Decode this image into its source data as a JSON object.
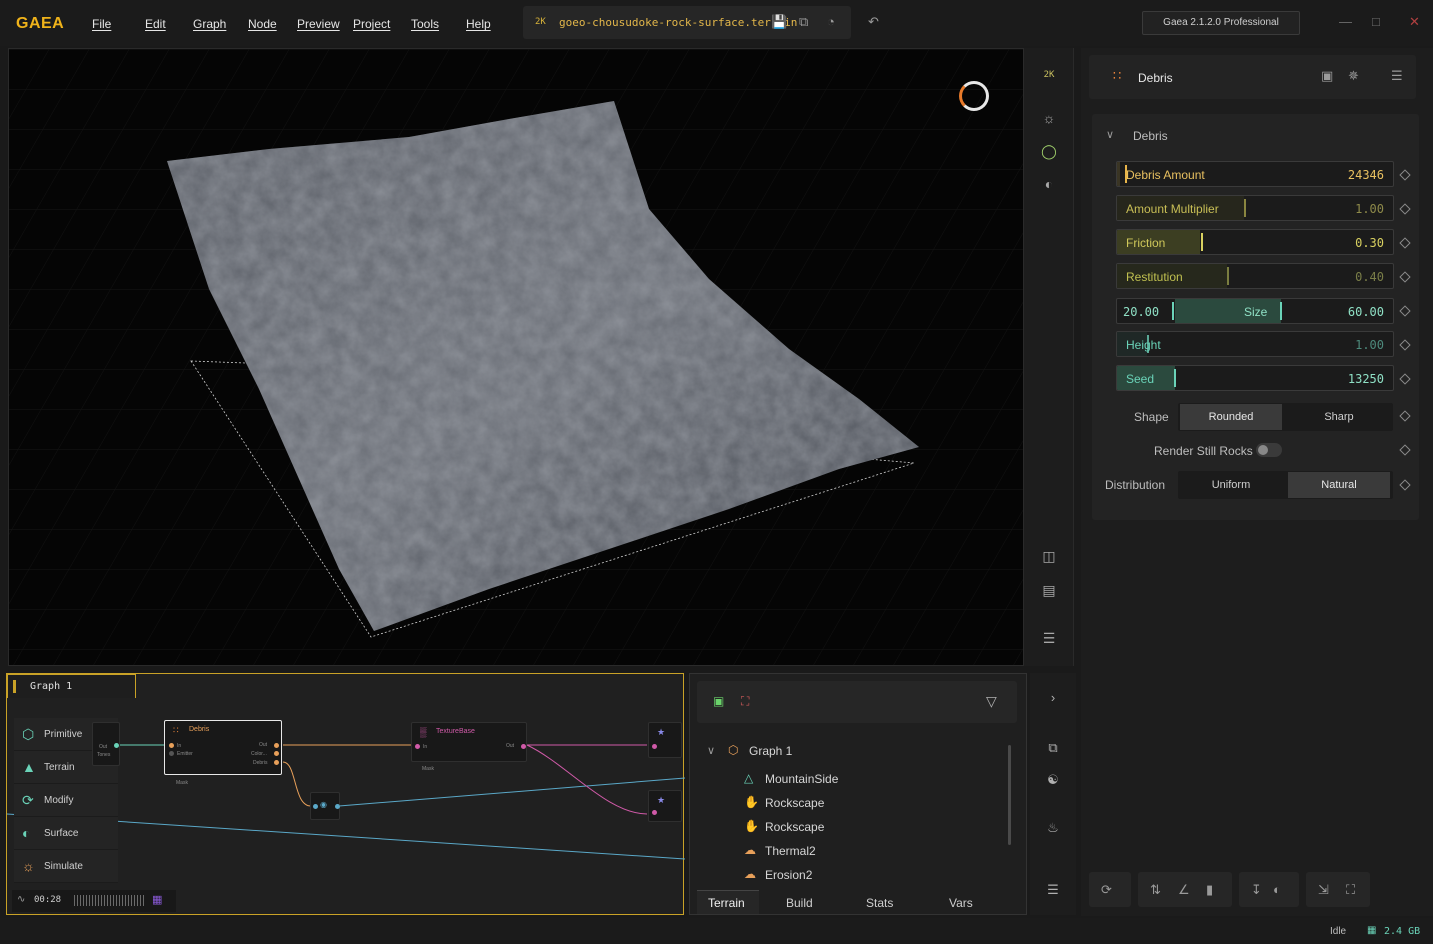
{
  "app": {
    "logo": "GAEA",
    "version": "Gaea 2.1.2.0 Professional"
  },
  "menu": [
    "File",
    "Edit",
    "Graph",
    "Node",
    "Preview",
    "Project",
    "Tools",
    "Help"
  ],
  "file": {
    "resolution": "2K",
    "name": "goeo-chousudoke-rock-surface.terrain"
  },
  "viewport_toolbar": {
    "resolution": "2K"
  },
  "properties": {
    "node_title": "Debris",
    "section": "Debris",
    "sliders": [
      {
        "label": "Debris Amount",
        "value": "24346",
        "fraction": 0.01
      },
      {
        "label": "Amount Multiplier",
        "value": "1.00",
        "fraction": 0.46
      },
      {
        "label": "Friction",
        "value": "0.30",
        "fraction": 0.3
      },
      {
        "label": "Restitution",
        "value": "0.40",
        "fraction": 0.4
      }
    ],
    "size": {
      "label": "Size",
      "min": "20.00",
      "max": "60.00"
    },
    "sliders2": [
      {
        "label": "Height",
        "value": "1.00",
        "fraction": 0.11
      },
      {
        "label": "Seed",
        "value": "13250",
        "fraction": 0.21
      }
    ],
    "shape": {
      "label": "Shape",
      "options": [
        "Rounded",
        "Sharp"
      ],
      "selected": "Rounded"
    },
    "render_still_rocks": {
      "label": "Render Still Rocks",
      "on": false
    },
    "distribution": {
      "label": "Distribution",
      "options": [
        "Uniform",
        "Natural"
      ],
      "selected": "Natural"
    }
  },
  "graph": {
    "tab": "Graph 1",
    "categories": [
      "Primitive",
      "Terrain",
      "Modify",
      "Surface",
      "Simulate"
    ],
    "nodes": {
      "debris": {
        "title": "Debris",
        "in": "In",
        "emitter": "Emitter",
        "out": "Out",
        "color": "Color...",
        "debris": "Debris",
        "mask": "Mask"
      },
      "texture": {
        "title": "TextureBase",
        "in": "In",
        "out": "Out",
        "mask": "Mask"
      },
      "primitive": {
        "out": "Out",
        "tones": "Tones"
      }
    },
    "timeline": "00:28"
  },
  "outline": {
    "root": "Graph 1",
    "items": [
      "MountainSide",
      "Rockscape",
      "Rockscape",
      "Thermal2",
      "Erosion2"
    ],
    "tabs": [
      "Terrain",
      "Build",
      "Stats",
      "Vars"
    ],
    "active_tab": "Terrain"
  },
  "status": {
    "state": "Idle",
    "memory": "2.4 GB"
  },
  "colors": {
    "accent": "#f0b31a",
    "teal": "#6ad3b8",
    "graph_border": "#c9a227"
  }
}
